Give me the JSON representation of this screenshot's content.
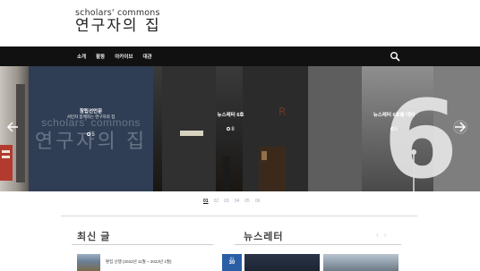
{
  "header": {
    "logo_en": "scholars' commons",
    "logo_ko": "연구자의 집"
  },
  "nav": {
    "items": [
      {
        "label": "소개"
      },
      {
        "label": "활동"
      },
      {
        "label": "아카이브"
      },
      {
        "label": "대관"
      }
    ],
    "search_icon": "search-icon"
  },
  "slider": {
    "slides": [
      {
        "title": "창립선언문",
        "subtitle": "서민자 함께하는 연구자의 집",
        "watermark_en": "scholars' commons",
        "watermark_ko": "연구자의 집",
        "comments": "5"
      },
      {
        "title": "뉴스레터 6호",
        "comments": "8"
      },
      {
        "title": "뉴스레터 6호를 대비",
        "comments": "5"
      }
    ],
    "prev_icon": "arrow-left-icon",
    "next_icon": "arrow-right-icon"
  },
  "pager": {
    "items": [
      "01",
      "02",
      "03",
      "04",
      "05",
      "06"
    ],
    "active_index": 0
  },
  "sections": {
    "recent": {
      "title": "최신 글",
      "first_post": "편집 선행 (2022년 11월 ~ 2023년 1월)"
    },
    "news": {
      "title": "뉴스레터",
      "arrows": "‹ ›",
      "date_month": "01",
      "date_day": "30"
    }
  },
  "colors": {
    "nav_bg": "#111111",
    "slide_blue": "#2f3e55",
    "badge_blue": "#2a5fa5"
  }
}
